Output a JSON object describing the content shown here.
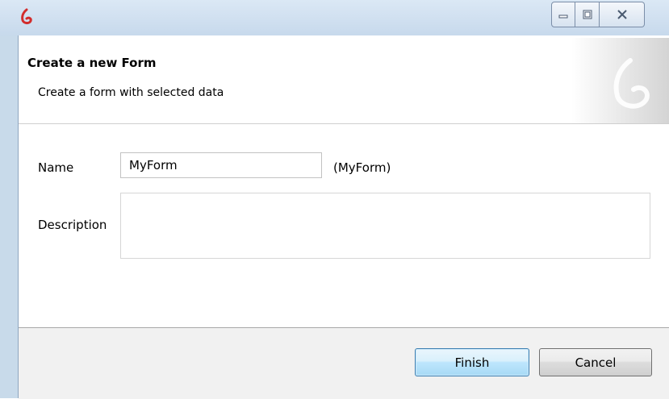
{
  "window": {
    "app_icon": "ls-logo-icon",
    "caption_buttons": [
      "minimize-icon",
      "maximize-icon",
      "close-icon"
    ]
  },
  "header": {
    "title": "Create a new Form",
    "subtitle": "Create a form with selected data",
    "logo_icon": "ls-logo-watermark-icon"
  },
  "form": {
    "name_label": "Name",
    "name_value": "MyForm",
    "name_hint": "(MyForm)",
    "description_label": "Description",
    "description_value": ""
  },
  "buttons": {
    "finish_label": "Finish",
    "cancel_label": "Cancel"
  },
  "colors": {
    "accent": "#d22c2c",
    "finish_border": "#3c7fb1"
  }
}
